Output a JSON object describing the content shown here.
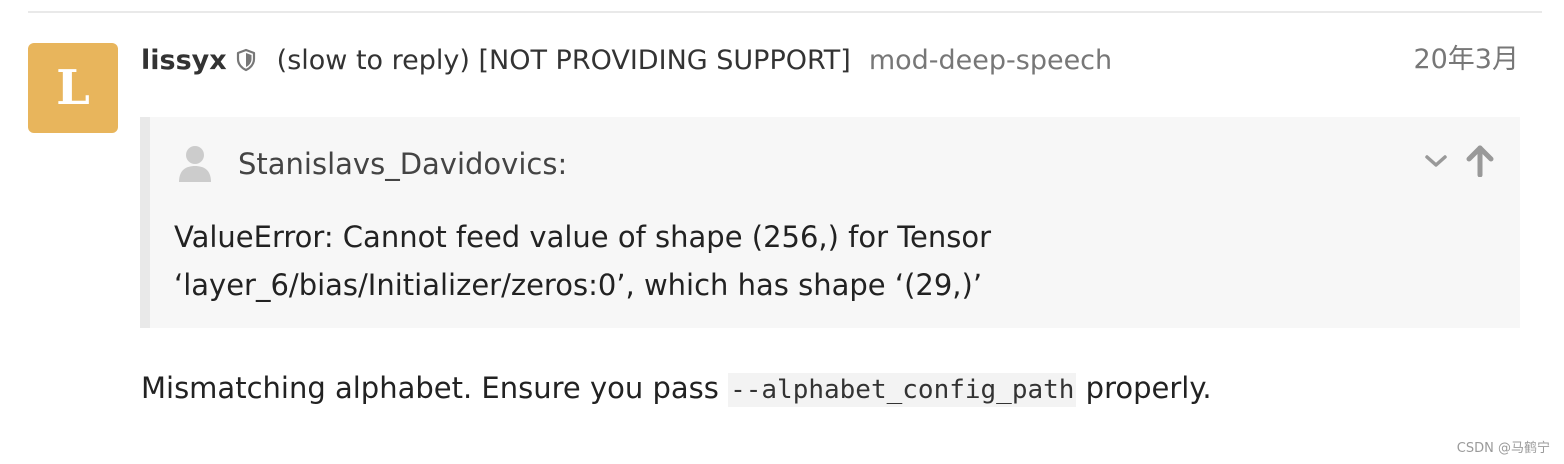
{
  "post": {
    "avatar_letter": "L",
    "avatar_color": "#e8b55c",
    "username": "lissyx",
    "moderator_icon": "shield-icon",
    "user_title": "(slow to reply) [NOT PROVIDING SUPPORT]",
    "user_group": "mod-deep-speech",
    "date": "20年3月"
  },
  "quote": {
    "author_icon": "person-icon",
    "author": "Stanislavs_Davidovics:",
    "collapse_icon": "chevron-down-icon",
    "jump_icon": "arrow-up-icon",
    "line1": "ValueError: Cannot feed value of shape (256,) for Tensor",
    "line2": "‘layer_6/bias/Initializer/zeros:0’, which has shape ‘(29,)’"
  },
  "reply": {
    "before": "Mismatching alphabet. Ensure you pass ",
    "code": "--alphabet_config_path",
    "after": " properly."
  },
  "watermark": "CSDN @马鹤宁"
}
